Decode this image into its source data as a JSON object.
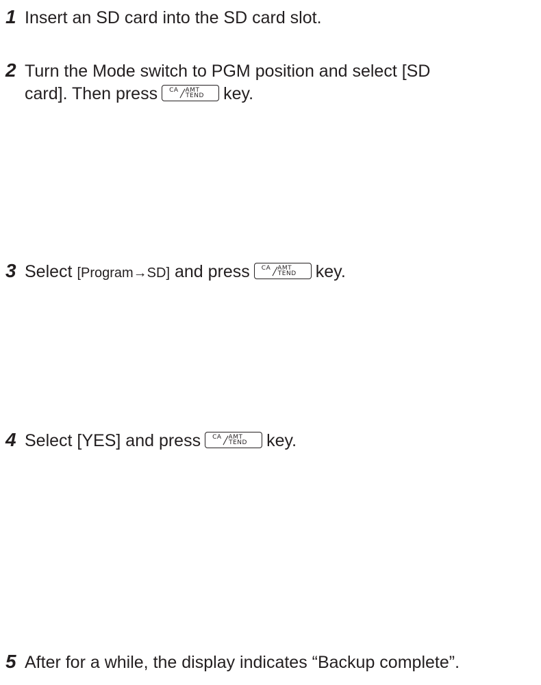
{
  "steps": [
    {
      "number": "1",
      "line1": "Insert an SD card into the SD card slot."
    },
    {
      "number": "2",
      "line1": "Turn the Mode switch to PGM position and select [SD",
      "line2_before_key": "card]. Then press",
      "line2_after_key": "key."
    },
    {
      "number": "3",
      "before_small": "Select",
      "small_text": "[Program→SD]",
      "after_small": "and press",
      "after_key": "key."
    },
    {
      "number": "4",
      "before_key": "Select [YES] and press",
      "after_key": "key."
    },
    {
      "number": "5",
      "line1": "After for a while, the display indicates “Backup complete”."
    }
  ],
  "key": {
    "top": "CA AMT",
    "bottom": "TEND",
    "icon": "ca-amt-tend-key-icon"
  }
}
